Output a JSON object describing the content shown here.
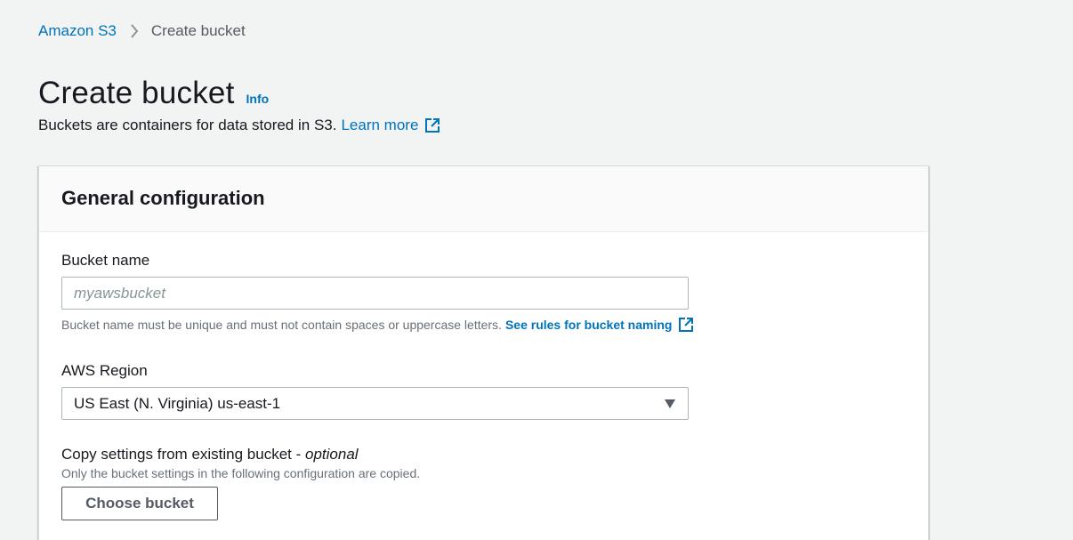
{
  "breadcrumb": {
    "root": "Amazon S3",
    "current": "Create bucket"
  },
  "header": {
    "title": "Create bucket",
    "info_label": "Info",
    "description": "Buckets are containers for data stored in S3.",
    "learn_more_label": "Learn more"
  },
  "panel": {
    "title": "General configuration",
    "bucket_name": {
      "label": "Bucket name",
      "value": "",
      "placeholder": "myawsbucket",
      "hint": "Bucket name must be unique and must not contain spaces or uppercase letters.",
      "hint_link": "See rules for bucket naming"
    },
    "region": {
      "label": "AWS Region",
      "selected": "US East (N. Virginia) us-east-1"
    },
    "copy_settings": {
      "label": "Copy settings from existing bucket -",
      "optional": "optional",
      "hint": "Only the bucket settings in the following configuration are copied.",
      "button_label": "Choose bucket"
    }
  },
  "colors": {
    "link": "#0073bb",
    "background": "#f2f3f3",
    "text": "#16191f",
    "muted": "#687078"
  },
  "icons": {
    "breadcrumb_separator": "chevron-right-icon",
    "external_link": "external-link-icon",
    "dropdown": "caret-down-icon"
  }
}
